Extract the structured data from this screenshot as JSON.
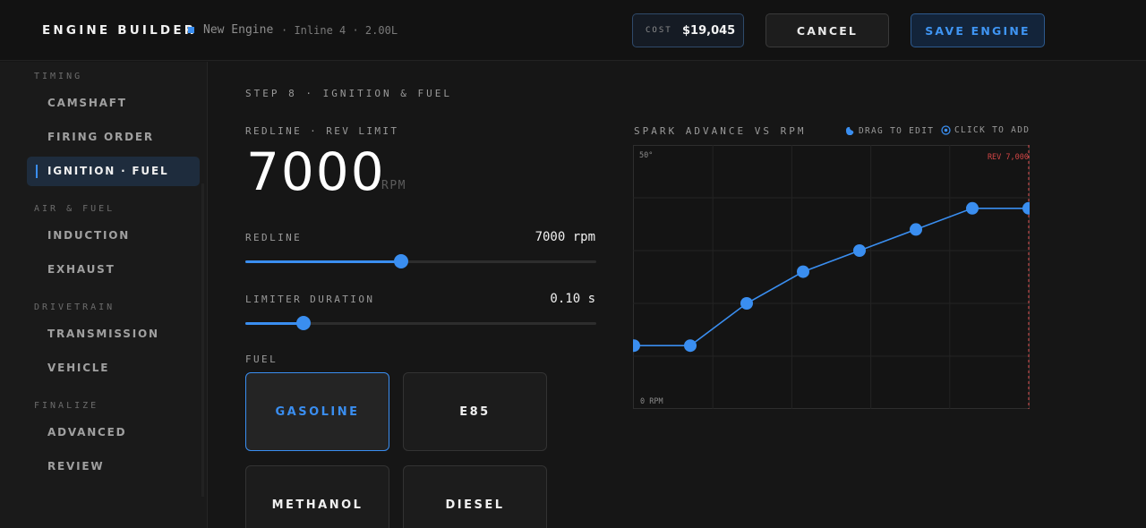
{
  "header": {
    "app_title": "ENGINE BUILDER",
    "engine_name": "New Engine",
    "engine_spec": "· Inline 4 · 2.00L",
    "cost_label": "COST",
    "cost_value": "$19,045",
    "cancel_label": "CANCEL",
    "save_label": "SAVE ENGINE"
  },
  "sidebar": {
    "groups": [
      {
        "title": "TIMING",
        "items": [
          {
            "label": "CAMSHAFT"
          },
          {
            "label": "FIRING ORDER"
          },
          {
            "label": "IGNITION · FUEL",
            "active": true
          }
        ]
      },
      {
        "title": "AIR & FUEL",
        "items": [
          {
            "label": "INDUCTION"
          },
          {
            "label": "EXHAUST"
          }
        ]
      },
      {
        "title": "DRIVETRAIN",
        "items": [
          {
            "label": "TRANSMISSION"
          },
          {
            "label": "VEHICLE"
          }
        ]
      },
      {
        "title": "FINALIZE",
        "items": [
          {
            "label": "ADVANCED"
          },
          {
            "label": "REVIEW"
          }
        ]
      }
    ]
  },
  "main": {
    "step_title": "STEP 8 · IGNITION & FUEL",
    "redline_section": "REDLINE · REV LIMIT",
    "rpm_value": "7000",
    "rpm_unit": "RPM",
    "redline": {
      "label": "REDLINE",
      "value_text": "7000 rpm",
      "fraction": 0.444
    },
    "limiter": {
      "label": "LIMITER DURATION",
      "value_text": "0.10 s",
      "fraction": 0.166
    },
    "fuel_label": "FUEL",
    "fuel_options": [
      {
        "label": "GASOLINE",
        "selected": true
      },
      {
        "label": "E85"
      },
      {
        "label": "METHANOL"
      },
      {
        "label": "DIESEL"
      }
    ]
  },
  "chart_panel": {
    "title": "SPARK ADVANCE VS RPM",
    "hint_drag": "DRAG TO EDIT",
    "hint_add": "CLICK TO ADD"
  },
  "chart_data": {
    "type": "line",
    "y_top_label": "50°",
    "x_left_label": "0 RPM",
    "limit_label": "REV 7,000",
    "xlim": [
      0,
      7000
    ],
    "ylim": [
      0,
      50
    ],
    "series": [
      {
        "x": [
          0,
          1000,
          2000,
          3000,
          4000,
          5000,
          6000,
          7000
        ],
        "values": [
          12,
          12,
          20,
          26,
          30,
          34,
          38,
          38
        ]
      }
    ],
    "grid": true,
    "colors": {
      "line": "#3a8ef0",
      "limit": "#e05050",
      "grid": "#232323"
    }
  }
}
